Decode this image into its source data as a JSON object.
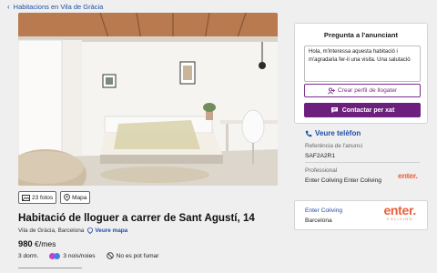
{
  "breadcrumb": {
    "label": "Habitacions en Vila de Gràcia",
    "icon": "chevron-left-icon"
  },
  "gallery": {
    "photos_label": "23 fotos",
    "map_label": "Mapa"
  },
  "listing": {
    "title": "Habitació de lloguer a carrer de Sant Agustí, 14",
    "location": "Vila de Gràcia, Barcelona",
    "map_link": "Veure mapa",
    "price_value": "980",
    "price_unit": "€/mes",
    "features": {
      "bedrooms": "3 dorm.",
      "roommates": "3 nois/noies",
      "smoking": "No es pot fumar"
    }
  },
  "contact": {
    "title": "Pregunta a l'anunciant",
    "message": "Hola, m'interessa aquesta habitació i m'agradaria fer-li una visita. Una salutació",
    "create_profile": "Crear perfil de llogater",
    "chat_button": "Contactar per xat"
  },
  "advertiser": {
    "phone_link": "Veure telèfon",
    "reference_label": "Referència de l'anunci",
    "reference_value": "SAF2A2R1",
    "professional_label": "Professional",
    "professional_value": "Enter Coliving Enter Coliving",
    "logo_text": "enter.",
    "agency_name": "Enter Coliving",
    "agency_city": "Barcelona",
    "logo_word": "enter.",
    "logo_subtitle": "COLIVING"
  },
  "colors": {
    "link": "#1e4fa8",
    "brand_purple": "#6d1f7e",
    "logo_orange": "#e8603c"
  }
}
